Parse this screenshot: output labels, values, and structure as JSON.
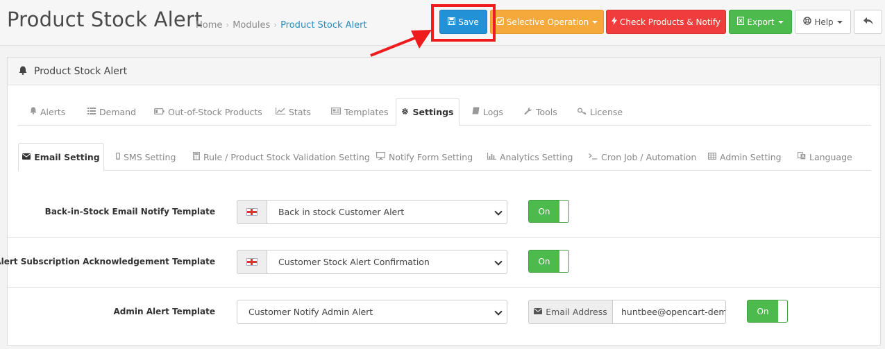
{
  "header": {
    "title": "Product Stock Alert",
    "breadcrumb": [
      "Home",
      "Modules",
      "Product Stock Alert"
    ],
    "buttons": {
      "save": "Save",
      "selective": "Selective Operation",
      "check": "Check Products & Notify",
      "export": "Export",
      "help": "Help"
    }
  },
  "panel": {
    "title": "Product Stock Alert",
    "main_tabs": [
      "Alerts",
      "Demand",
      "Out-of-Stock Products",
      "Stats",
      "Templates",
      "Settings",
      "Logs",
      "Tools",
      "License"
    ],
    "sub_tabs": [
      "Email Setting",
      "SMS Setting",
      "Rule / Product Stock Validation Setting",
      "Notify Form Setting",
      "Analytics Setting",
      "Cron Job / Automation",
      "Admin Setting",
      "Language"
    ]
  },
  "settings": {
    "rows": [
      {
        "label": "Back-in-Stock Email Notify Template",
        "value": "Back in stock Customer Alert",
        "toggle": "On"
      },
      {
        "label": "Alert Subscription Acknowledgement Template",
        "value": "Customer Stock Alert Confirmation",
        "toggle": "On"
      },
      {
        "label": "Admin Alert Template",
        "value": "Customer Notify Admin Alert",
        "toggle": "On",
        "email_label": "Email Address",
        "email_value": "huntbee@opencart-dem"
      }
    ]
  },
  "colors": {
    "save": "#2291d6",
    "selective": "#f4a93a",
    "check": "#f03c3c",
    "export": "#4cba4c",
    "highlight": "#ee1c1c"
  }
}
